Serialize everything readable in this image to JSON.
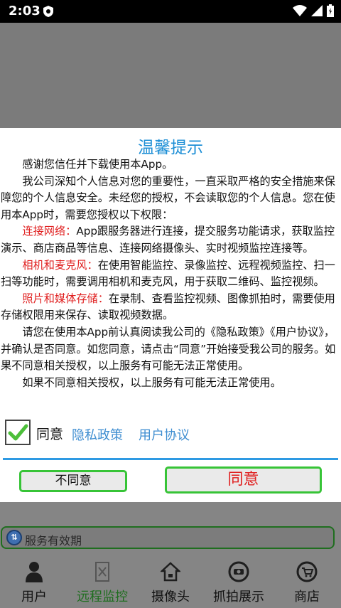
{
  "status": {
    "time": "2:03"
  },
  "dialog": {
    "title": "温馨提示",
    "intro": "感谢您信任并下载使用本App。",
    "para1": "我公司深知个人信息对您的重要性，一直采取严格的安全措施来保障您的个人信息安全。未经您的授权，不会读取您的个人信息。您在使用本App时，需要您授权以下权限：",
    "network_label": "连接网络：",
    "network_text": "App跟服务器进行连接，提交服务功能请求，获取监控演示、商店商品等信息、连接网络摄像头、实时视频监控连接等。",
    "camera_label": "相机和麦克风：",
    "camera_text": "在使用智能监控、录像监控、远程视频监控、扫一扫等功能时，需要调用相机和麦克风，用于获取二维码、监控视频。",
    "storage_label": "照片和媒体存储：",
    "storage_text": "在录制、查看监控视频、图像抓拍时，需要使用存储权限用来保存、读取视频数据。",
    "para2": "请您在使用本App前认真阅读我公司的《隐私政策》《用户协议》，并确认是否同意。如您同意，请点击“同意”开始接受我公司的服务。如果不同意相关授权，以上服务有可能无法正常使用。",
    "para3": "如果不同意相关授权，以上服务有可能无法正常使用。",
    "agree_label": "同意",
    "privacy_link": "隐私政策",
    "terms_link": "用户协议",
    "disagree_button": "不同意",
    "agree_button": "同意"
  },
  "background": {
    "service_text": "服务有效期",
    "tabs": [
      {
        "label": "用户",
        "icon": "user-icon"
      },
      {
        "label": "远程监控",
        "icon": "remote-monitor-icon"
      },
      {
        "label": "摄像头",
        "icon": "camera-home-icon"
      },
      {
        "label": "抓拍展示",
        "icon": "snapshot-icon"
      },
      {
        "label": "商店",
        "icon": "shop-cart-icon"
      }
    ]
  },
  "colors": {
    "accent": "#1e8fd6",
    "warning": "#e02020",
    "button_border": "#37c437"
  }
}
